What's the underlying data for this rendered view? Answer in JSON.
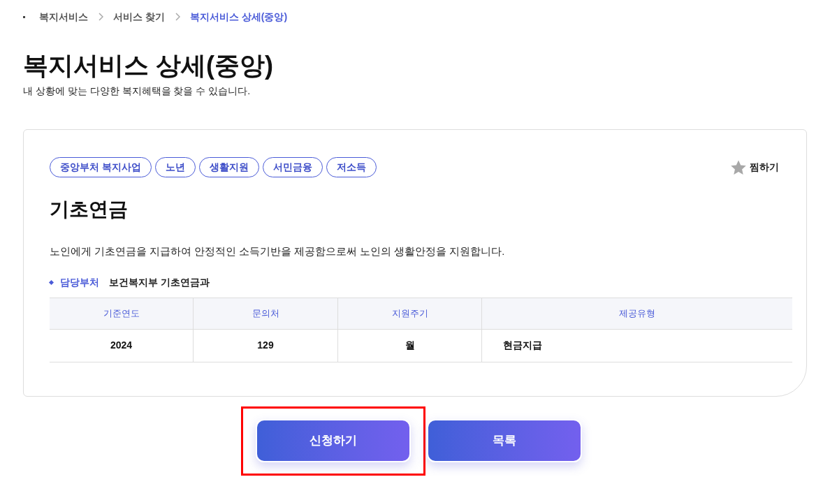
{
  "breadcrumb": [
    {
      "label": "복지서비스",
      "selected": false
    },
    {
      "label": "서비스 찾기",
      "selected": false
    },
    {
      "label": "복지서비스 상세(중앙)",
      "selected": true
    }
  ],
  "page": {
    "title": "복지서비스 상세(중앙)",
    "subtitle": "내 상황에 맞는 다양한 복지혜택을 찾을 수 있습니다."
  },
  "card": {
    "tags": [
      "중앙부처 복지사업",
      "노년",
      "생활지원",
      "서민금융",
      "저소득"
    ],
    "bookmark": {
      "label": "찜하기",
      "selected": false
    },
    "title": "기초연금",
    "description": "노인에게 기초연금을 지급하여 안정적인 소득기반을 제공함으로써 노인의 생활안정을 지원합니다.",
    "department": {
      "label": "담당부처",
      "value": "보건복지부 기초연금과"
    },
    "table": {
      "columns": [
        "기준연도",
        "문의처",
        "지원주기",
        "제공유형"
      ],
      "rows": [
        [
          "2024",
          "129",
          "월",
          "현금지급"
        ]
      ]
    }
  },
  "buttons": [
    {
      "label": "신청하기",
      "highlighted": true
    },
    {
      "label": "목록",
      "highlighted": false
    }
  ]
}
